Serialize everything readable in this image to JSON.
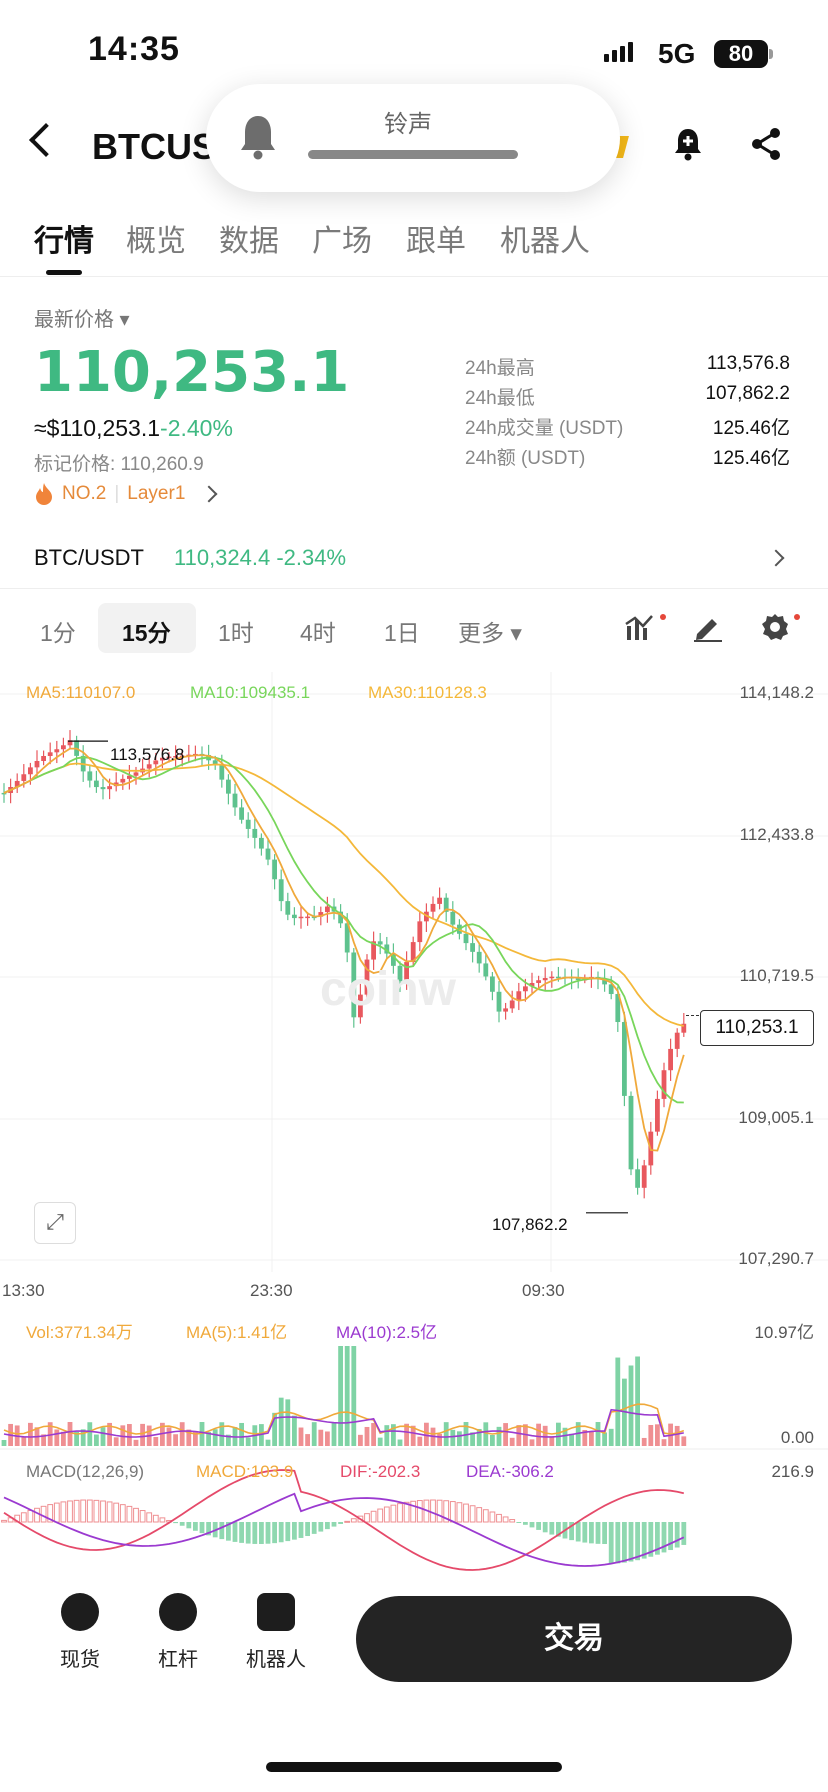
{
  "status_bar": {
    "time": "14:35",
    "network": "5G",
    "battery": "80"
  },
  "header": {
    "title": "BTCUS",
    "ringer_label": "铃声"
  },
  "tabs": [
    "行情",
    "概览",
    "数据",
    "广场",
    "跟单",
    "机器人"
  ],
  "price": {
    "latest_label": "最新价格",
    "last": "110,253.1",
    "approx": "≈$110,253.1",
    "change": "-2.40%",
    "mark": "标记价格: 110,260.9",
    "rank": "NO.2",
    "tag": "Layer1"
  },
  "stats": [
    {
      "label": "24h最高",
      "value": "113,576.8"
    },
    {
      "label": "24h最低",
      "value": "107,862.2"
    },
    {
      "label": "24h成交量 (USDT)",
      "value": "125.46亿"
    },
    {
      "label": "24h额 (USDT)",
      "value": "125.46亿"
    }
  ],
  "market": {
    "pair": "BTC/USDT",
    "price": "110,324.4 -2.34%"
  },
  "intervals": [
    "1分",
    "15分",
    "1时",
    "4时",
    "1日",
    "更多"
  ],
  "chart": {
    "ma5": "MA5:110107.0",
    "ma10": "MA10:109435.1",
    "ma30": "MA30:110128.3",
    "price_axis": [
      "114,148.2",
      "112,433.8",
      "110,719.5",
      "109,005.1",
      "107,290.7"
    ],
    "current_price_tag": "110,253.1",
    "high_label": "113,576.8",
    "low_label": "107,862.2",
    "time_axis": [
      "13:30",
      "23:30",
      "09:30"
    ],
    "watermark": "coinw",
    "colors": {
      "up": "#e8585e",
      "down": "#5ec28e",
      "ma5": "#f0a93b",
      "ma10": "#78d65b",
      "ma30": "#f4b83a"
    }
  },
  "volume": {
    "vol": "Vol:3771.34万",
    "ma5": "MA(5):1.41亿",
    "ma10": "MA(10):2.5亿",
    "axis_top": "10.97亿",
    "axis_bottom": "0.00"
  },
  "macd": {
    "label": "MACD(12,26,9)",
    "macd": "MACD:103.9",
    "dif": "DIF:-202.3",
    "dea": "DEA:-306.2",
    "axis_top": "216.9"
  },
  "bottom": {
    "items": [
      "现货",
      "杠杆",
      "机器人"
    ],
    "trade": "交易"
  }
}
